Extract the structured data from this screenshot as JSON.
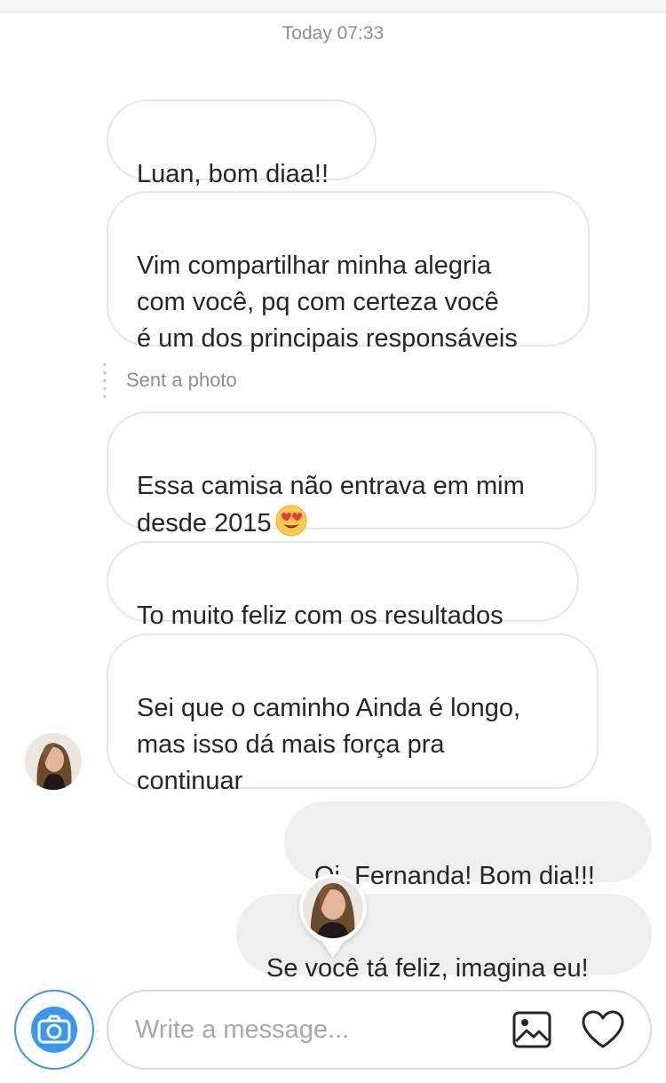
{
  "header": {
    "timestamp": "Today 07:33"
  },
  "messages": {
    "m1": "Luan, bom diaa!!",
    "m2": "Vim compartilhar minha alegria\ncom você, pq com certeza você\né um dos principais responsáveis",
    "sent_photo_label": "Sent a photo",
    "m3_text": "Essa camisa não entrava em mim\ndesde 2015",
    "m3_emoji": "heart-eyes-emoji",
    "m4": "To muito feliz com os resultados",
    "m5": "Sei que o caminho Ainda é longo,\nmas isso dá mais força pra\ncontinuar",
    "m6": "Oi, Fernanda! Bom dia!!!",
    "m7": "Se você tá feliz, imagina eu!"
  },
  "composer": {
    "placeholder": "Write a message...",
    "camera_icon": "camera-icon",
    "gallery_icon": "image-icon",
    "like_icon": "heart-icon"
  },
  "colors": {
    "accent": "#3897f0",
    "incoming_border": "#e6e6e6",
    "outgoing_bg": "#efefef",
    "secondary_text": "#8e8e8e"
  }
}
